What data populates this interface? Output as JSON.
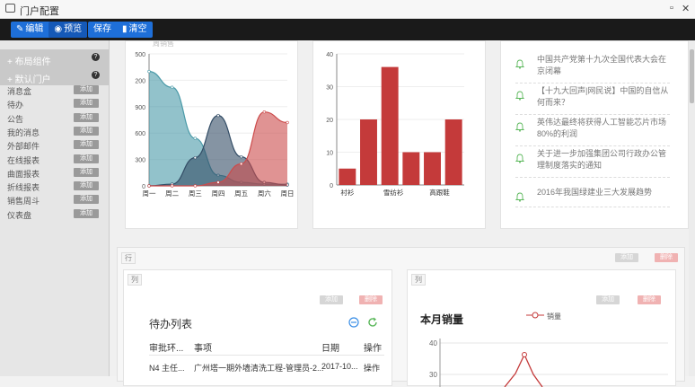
{
  "window": {
    "title": "门户配置",
    "restore_glyph": "▫",
    "close_glyph": "✕"
  },
  "toolbar": {
    "edit": "编辑",
    "preview": "预览",
    "save": "保存",
    "clear": "清空"
  },
  "sidebar": {
    "headers": [
      {
        "label": "布局组件"
      },
      {
        "label": "默认门户"
      }
    ],
    "add_label": "添加",
    "items": [
      "消息盒",
      "待办",
      "公告",
      "我的消息",
      "外部邮件",
      "在线报表",
      "曲面报表",
      "折线报表",
      "销售周斗",
      "仪表盘"
    ]
  },
  "chart_area": {
    "type": "area",
    "title": "周销售",
    "categories": [
      "周一",
      "周二",
      "周三",
      "周四",
      "周五",
      "周六",
      "周日"
    ],
    "yticks": [
      "500",
      "200",
      "900",
      "600",
      "300",
      "0"
    ],
    "ylim": [
      0,
      1500
    ],
    "series": [
      {
        "values": [
          1300,
          1120,
          540,
          120,
          40,
          20,
          20
        ],
        "color": "#4a9aa8"
      },
      {
        "values": [
          0,
          20,
          320,
          800,
          330,
          40,
          10
        ],
        "color": "#334d66"
      },
      {
        "values": [
          0,
          0,
          0,
          40,
          250,
          840,
          720
        ],
        "color": "#cc4b4b"
      }
    ]
  },
  "chart_bar": {
    "type": "bar",
    "values": [
      5,
      20,
      36,
      10,
      10,
      20
    ],
    "xlabels": [
      "衬衫",
      "雪纺衫",
      "高跟鞋"
    ],
    "yticks": [
      "40",
      "30",
      "20",
      "10",
      "0"
    ],
    "ylim": [
      0,
      40
    ],
    "color": "#c43a3a"
  },
  "news": [
    "中国共产党第十九次全国代表大会在京闭幕",
    "【十九大回声|网民说】中国的自信从何而来？",
    "英伟达最终将获得人工智能芯片市场80%的利润",
    "关于进一步加强集团公司行政办公管理制度落实的通知",
    "2016年我国绿建业三大发展趋势"
  ],
  "row_section": {
    "row_tag": "行",
    "col_tag": "列",
    "add": "添加",
    "del": "删除"
  },
  "todo": {
    "title": "待办列表",
    "headers": [
      "审批环...",
      "事项",
      "日期",
      "操作"
    ],
    "rows": [
      [
        "N4 主任...",
        "广州塔一期外墙清洗工程-管理员-2...",
        "2017-10...",
        "操作"
      ]
    ]
  },
  "sales": {
    "title": "本月销量",
    "legend": "销量",
    "yticks": [
      "40",
      "30"
    ],
    "color": "#c43a3a"
  },
  "colors": {
    "accent": "#1e6fd9",
    "red": "#c43a3a",
    "green": "#5cb85c"
  }
}
